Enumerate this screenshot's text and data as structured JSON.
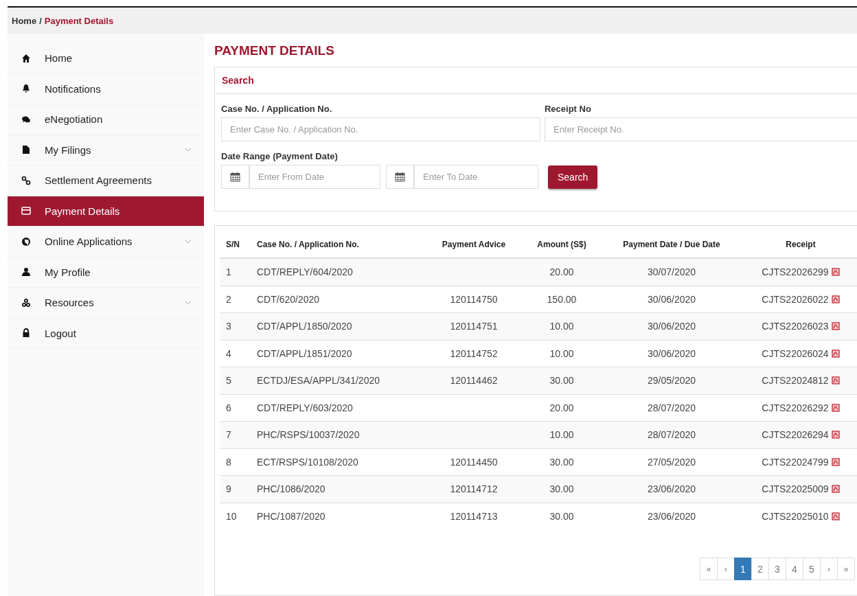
{
  "breadcrumb": [
    {
      "label": "Home"
    },
    {
      "label": "Payment Details"
    }
  ],
  "breadcrumb_separator": "/",
  "sidebar": {
    "items": [
      {
        "label": "Home",
        "selected": false,
        "expandable": false
      },
      {
        "label": "Notifications",
        "selected": false,
        "expandable": false
      },
      {
        "label": "eNegotiation",
        "selected": false,
        "expandable": false
      },
      {
        "label": "My Filings",
        "selected": false,
        "expandable": true
      },
      {
        "label": "Settlement Agreements",
        "selected": false,
        "expandable": false
      },
      {
        "label": "Payment Details",
        "selected": true,
        "expandable": false
      },
      {
        "label": "Online Applications",
        "selected": false,
        "expandable": true
      },
      {
        "label": "My Profile",
        "selected": false,
        "expandable": false
      },
      {
        "label": "Resources",
        "selected": false,
        "expandable": true
      },
      {
        "label": "Logout",
        "selected": false,
        "expandable": false
      }
    ]
  },
  "page_title": "PAYMENT DETAILS",
  "search": {
    "title": "Search",
    "case_field": {
      "label": "Case No. / Application No.",
      "placeholder": "Enter Case No. / Application No."
    },
    "receipt_field": {
      "label": "Receipt No",
      "placeholder": "Enter Receipt No."
    },
    "date_range": {
      "label": "Date Range (Payment Date)",
      "from_placeholder": "Enter From Date",
      "to_placeholder": "Enter To Date"
    },
    "button": "Search"
  },
  "table": {
    "columns": [
      "S/N",
      "Case No. / Application No.",
      "Payment Advice",
      "Amount (S$)",
      "Payment Date / Due Date",
      "Receipt"
    ],
    "rows": [
      {
        "sn": "1",
        "case_no": "CDT/REPLY/604/2020",
        "amount": "20.00",
        "date": "30/07/2020",
        "receipt": "CJTS22026299"
      },
      {
        "sn": "2",
        "case_no": "CDT/620/2020",
        "payment_advice": "120114750",
        "amount": "150.00",
        "date": "30/06/2020",
        "receipt": "CJTS22026022"
      },
      {
        "sn": "3",
        "case_no": "CDT/APPL/1850/2020",
        "payment_advice": "120114751",
        "amount": "10.00",
        "date": "30/06/2020",
        "receipt": "CJTS22026023"
      },
      {
        "sn": "4",
        "case_no": "CDT/APPL/1851/2020",
        "payment_advice": "120114752",
        "amount": "10.00",
        "date": "30/06/2020",
        "receipt": "CJTS22026024"
      },
      {
        "sn": "5",
        "case_no": "ECTDJ/ESA/APPL/341/2020",
        "payment_advice": "120114462",
        "amount": "30.00",
        "date": "29/05/2020",
        "receipt": "CJTS22024812"
      },
      {
        "sn": "6",
        "case_no": "CDT/REPLY/603/2020",
        "amount": "20.00",
        "date": "28/07/2020",
        "receipt": "CJTS22026292"
      },
      {
        "sn": "7",
        "case_no": "PHC/RSPS/10037/2020",
        "amount": "10.00",
        "date": "28/07/2020",
        "receipt": "CJTS22026294"
      },
      {
        "sn": "8",
        "case_no": "ECT/RSPS/10108/2020",
        "payment_advice": "120114450",
        "amount": "30.00",
        "date": "27/05/2020",
        "receipt": "CJTS22024799"
      },
      {
        "sn": "9",
        "case_no": "PHC/1086/2020",
        "payment_advice": "120114712",
        "amount": "30.00",
        "date": "23/06/2020",
        "receipt": "CJTS22025009"
      },
      {
        "sn": "10",
        "case_no": "PHC/1087/2020",
        "payment_advice": "120114713",
        "amount": "30.00",
        "date": "23/06/2020",
        "receipt": "CJTS22025010"
      }
    ]
  },
  "pagination": [
    {
      "label": "«",
      "selected": false
    },
    {
      "label": "‹",
      "selected": false
    },
    {
      "label": "1",
      "selected": true
    },
    {
      "label": "2",
      "selected": false
    },
    {
      "label": "3",
      "selected": false
    },
    {
      "label": "4",
      "selected": false
    },
    {
      "label": "5",
      "selected": false
    },
    {
      "label": "›",
      "selected": false
    },
    {
      "label": "»",
      "selected": false
    }
  ]
}
